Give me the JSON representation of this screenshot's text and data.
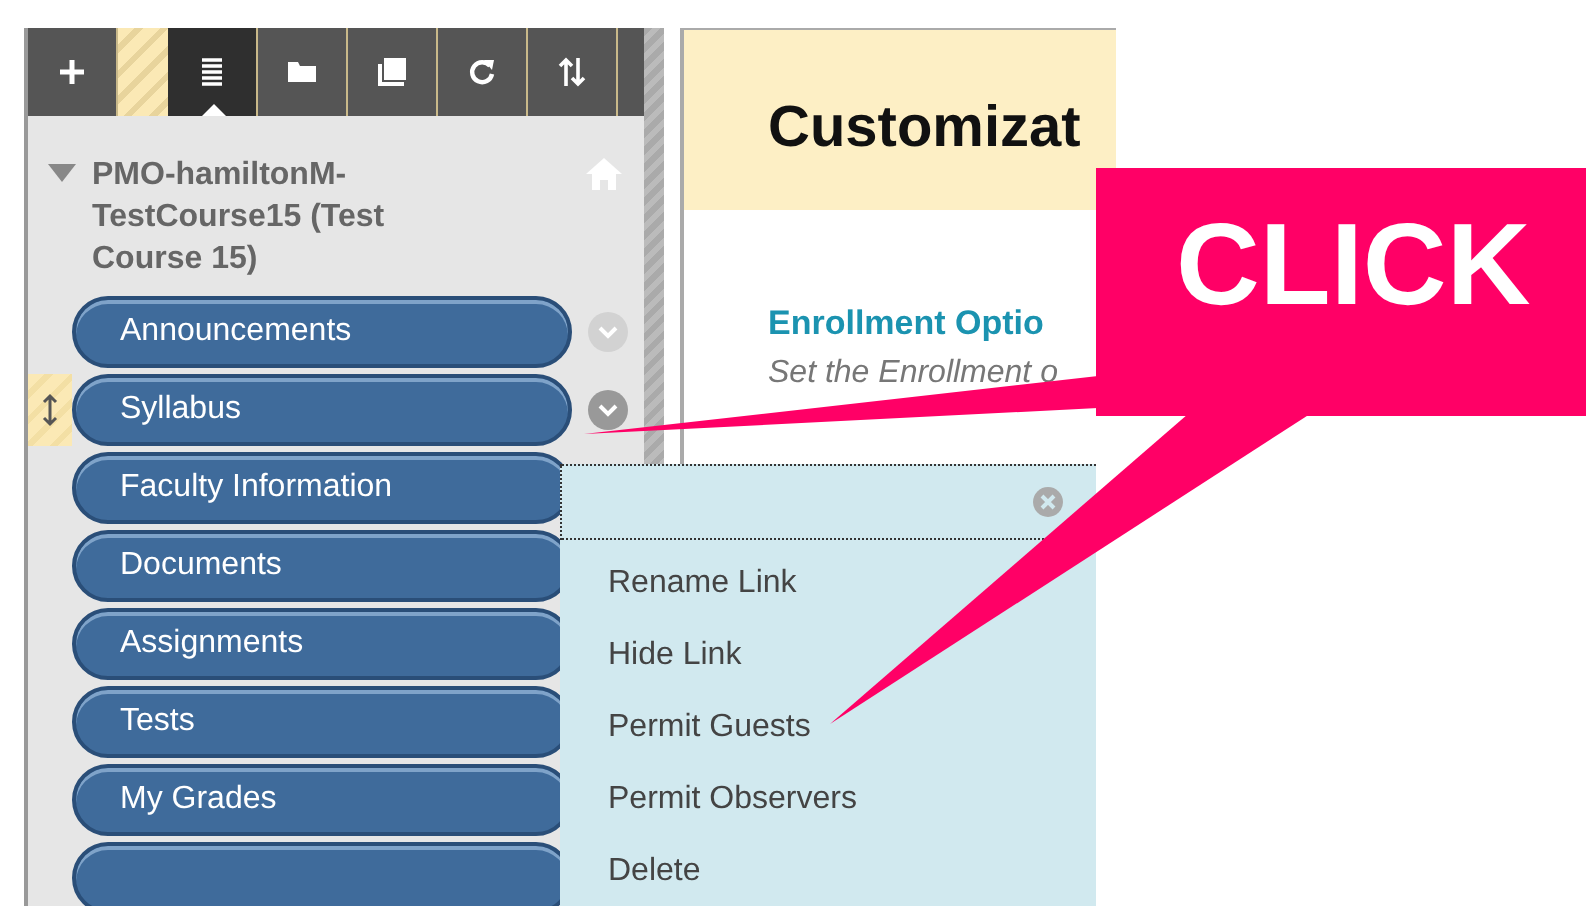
{
  "toolbar": [
    {
      "kind": "add",
      "selected": false
    },
    {
      "kind": "list",
      "selected": true
    },
    {
      "kind": "folder",
      "selected": false
    },
    {
      "kind": "window",
      "selected": false
    },
    {
      "kind": "refresh",
      "selected": false
    },
    {
      "kind": "sort",
      "selected": false
    }
  ],
  "course": {
    "title": "PMO-hamiltonM-TestCourse15 (Test Course 15)",
    "expanded": true
  },
  "menu_items": [
    {
      "label": "Announcements",
      "selected": false
    },
    {
      "label": "Syllabus",
      "selected": true
    },
    {
      "label": "Faculty Information",
      "selected": false
    },
    {
      "label": "Documents",
      "selected": false
    },
    {
      "label": "Assignments",
      "selected": false
    },
    {
      "label": "Tests",
      "selected": false
    },
    {
      "label": "My Grades",
      "selected": false
    },
    {
      "selected": false
    }
  ],
  "page": {
    "title": "Customizat",
    "section": "Enrollment Optio",
    "description": "Set the Enrollment o"
  },
  "context_menu": {
    "items": [
      "Rename Link",
      "Hide Link",
      "Permit Guests",
      "Permit Observers",
      "Delete"
    ]
  },
  "callout": {
    "label": "CLICK"
  }
}
